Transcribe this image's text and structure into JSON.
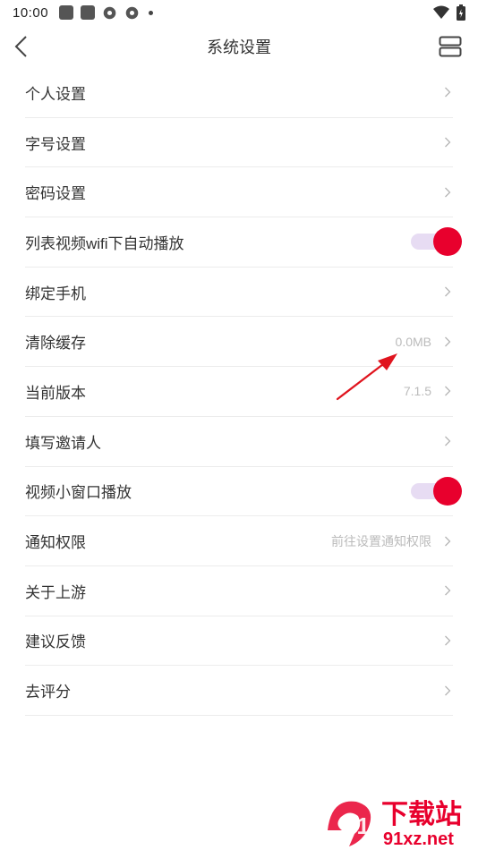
{
  "status_bar": {
    "time": "10:00"
  },
  "nav": {
    "title": "系统设置"
  },
  "settings": [
    {
      "label": "个人设置",
      "value": ""
    },
    {
      "label": "字号设置",
      "value": ""
    },
    {
      "label": "密码设置",
      "value": ""
    },
    {
      "label": "列表视频wifi下自动播放",
      "value": ""
    },
    {
      "label": "绑定手机",
      "value": ""
    },
    {
      "label": "清除缓存",
      "value": "0.0MB"
    },
    {
      "label": "当前版本",
      "value": "7.1.5"
    },
    {
      "label": "填写邀请人",
      "value": ""
    },
    {
      "label": "视频小窗口播放",
      "value": ""
    },
    {
      "label": "通知权限",
      "value": "前往设置通知权限"
    },
    {
      "label": "关于上游",
      "value": ""
    },
    {
      "label": "建议反馈",
      "value": ""
    },
    {
      "label": "去评分",
      "value": ""
    }
  ],
  "toggles": {
    "wifi_autoplay": true,
    "mini_window": true
  },
  "watermark": {
    "main": "下载站",
    "sub": "91xz.net",
    "logo_text": "91"
  },
  "colors": {
    "accent": "#e8002d",
    "toggle_track": "#e7dcf3",
    "annotation_arrow": "#e0141e"
  }
}
